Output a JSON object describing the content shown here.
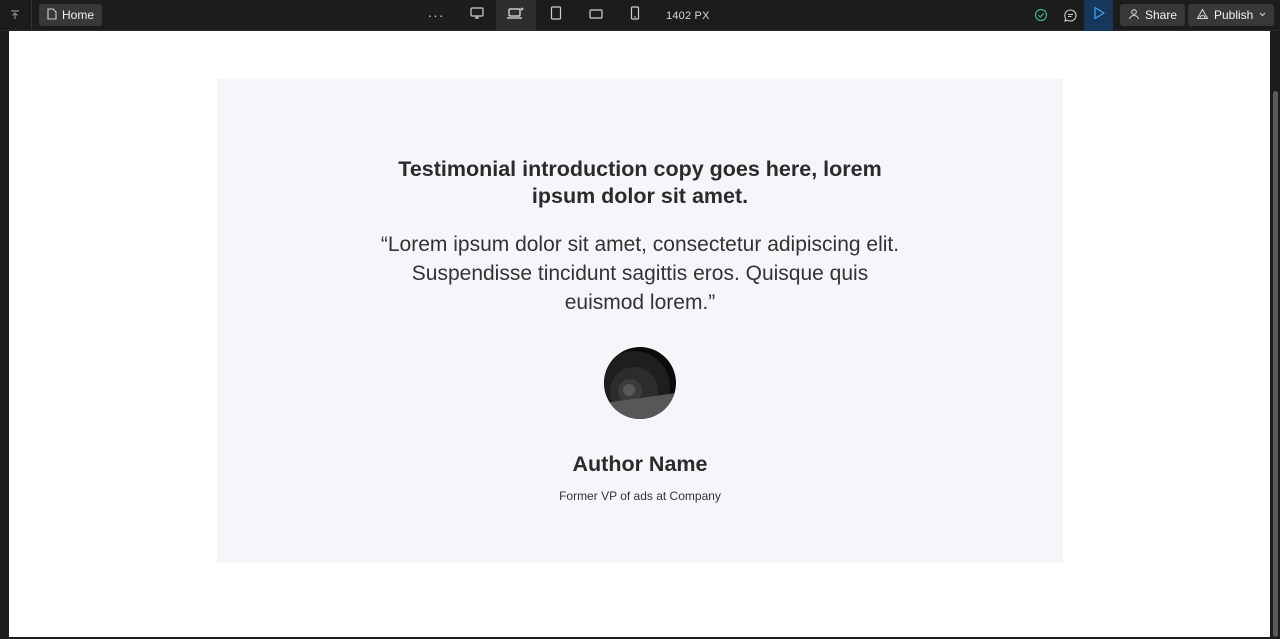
{
  "toolbar": {
    "page_name": "Home",
    "more_label": "···",
    "breakpoint_width": "1402 PX",
    "share_label": "Share",
    "publish_label": "Publish",
    "icons": {
      "left": "collapse-icon",
      "page": "page-icon",
      "desktop": "desktop-icon",
      "laptop": "laptop-star-icon",
      "tablet": "tablet-icon",
      "tablet_landscape": "tablet-landscape-icon",
      "mobile": "mobile-icon",
      "status": "check-circle-icon",
      "comment": "comment-icon",
      "preview": "play-icon",
      "user": "user-icon",
      "publish": "publish-icon",
      "chevron": "chevron-down-icon"
    },
    "active_breakpoint": "laptop",
    "colors": {
      "accent": "#4a9cf0",
      "status_ok": "#3fb87f",
      "preview_bg": "#15375c"
    }
  },
  "testimonial": {
    "intro": "Testimonial introduction copy goes here, lorem ipsum dolor sit amet.",
    "quote": "“Lorem ipsum dolor sit amet, consectetur adipiscing elit. Suspendisse tincidunt sagittis eros. Quisque quis euismod lorem.”",
    "author_name": "Author Name",
    "author_role": "Former VP of ads at Company"
  }
}
